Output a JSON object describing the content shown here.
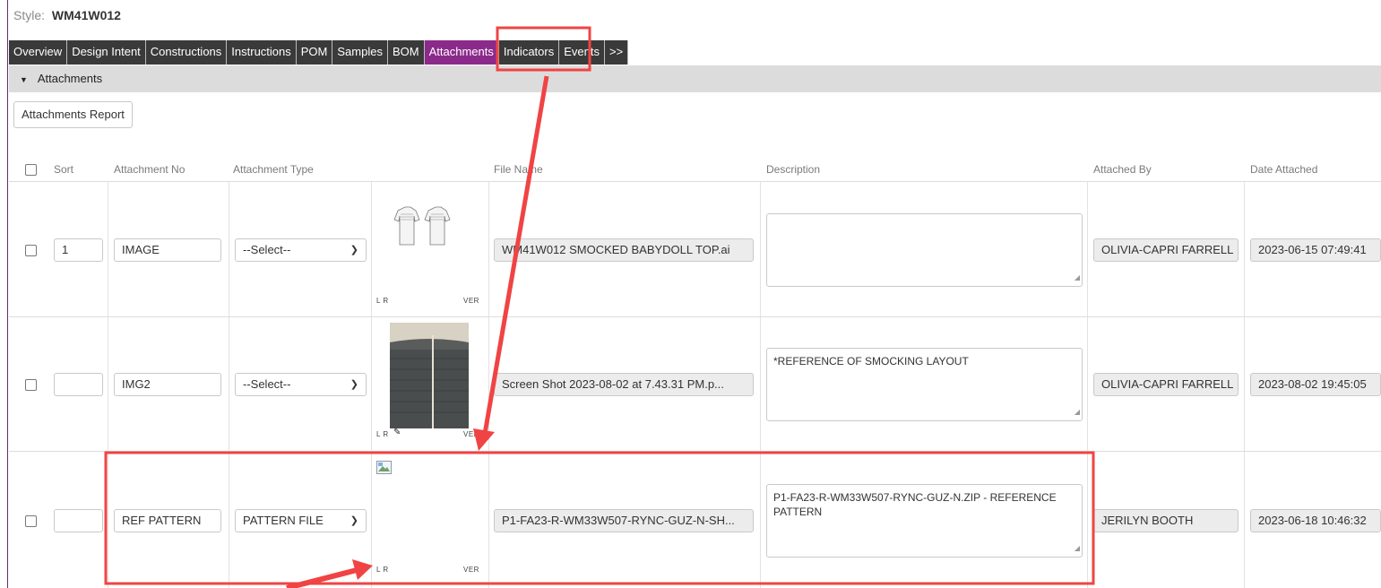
{
  "header": {
    "style_label": "Style:",
    "style_value": "WM41W012"
  },
  "tabs": [
    {
      "label": "Overview"
    },
    {
      "label": "Design Intent"
    },
    {
      "label": "Constructions"
    },
    {
      "label": "Instructions"
    },
    {
      "label": "POM"
    },
    {
      "label": "Samples"
    },
    {
      "label": "BOM"
    },
    {
      "label": "Attachments"
    },
    {
      "label": "Indicators"
    },
    {
      "label": "Events"
    },
    {
      "label": ">>"
    }
  ],
  "section": {
    "title": "Attachments",
    "report_button": "Attachments Report"
  },
  "columns": {
    "sort": "Sort",
    "attachment_no": "Attachment No",
    "attachment_type": "Attachment Type",
    "file_name": "File Name",
    "description": "Description",
    "attached_by": "Attached By",
    "date_attached": "Date Attached"
  },
  "thumb_labels": {
    "lr": "L R",
    "ver": "VER"
  },
  "rows": [
    {
      "sort": "1",
      "attachment_no": "IMAGE",
      "attachment_type": "--Select--",
      "file_name": "WM41W012 SMOCKED BABYDOLL TOP.ai",
      "description": "",
      "attached_by": "OLIVIA-CAPRI FARRELL",
      "date_attached": "2023-06-15 07:49:41",
      "thumbnail": "garment-sketch-icon"
    },
    {
      "sort": "",
      "attachment_no": "IMG2",
      "attachment_type": "--Select--",
      "file_name": "Screen Shot 2023-08-02 at 7.43.31 PM.p...",
      "description": "*REFERENCE OF SMOCKING LAYOUT",
      "attached_by": "OLIVIA-CAPRI FARRELL",
      "date_attached": "2023-08-02 19:45:05",
      "thumbnail": "fabric-photo"
    },
    {
      "sort": "",
      "attachment_no": "REF PATTERN",
      "attachment_type": "PATTERN FILE",
      "file_name": "P1-FA23-R-WM33W507-RYNC-GUZ-N-SH...",
      "description": "P1-FA23-R-WM33W507-RYNC-GUZ-N.ZIP - REFERENCE PATTERN",
      "attached_by": "JERILYN BOOTH",
      "date_attached": "2023-06-18 10:46:32",
      "thumbnail": "broken-image-icon"
    }
  ],
  "colors": {
    "active_tab": "#8b2a8b",
    "tab": "#3a3a3a",
    "annotation": "#f04444"
  },
  "icons": [
    "caret-down-icon",
    "chevron-down-icon",
    "edit-pencil-icon",
    "resize-grip-icon"
  ]
}
